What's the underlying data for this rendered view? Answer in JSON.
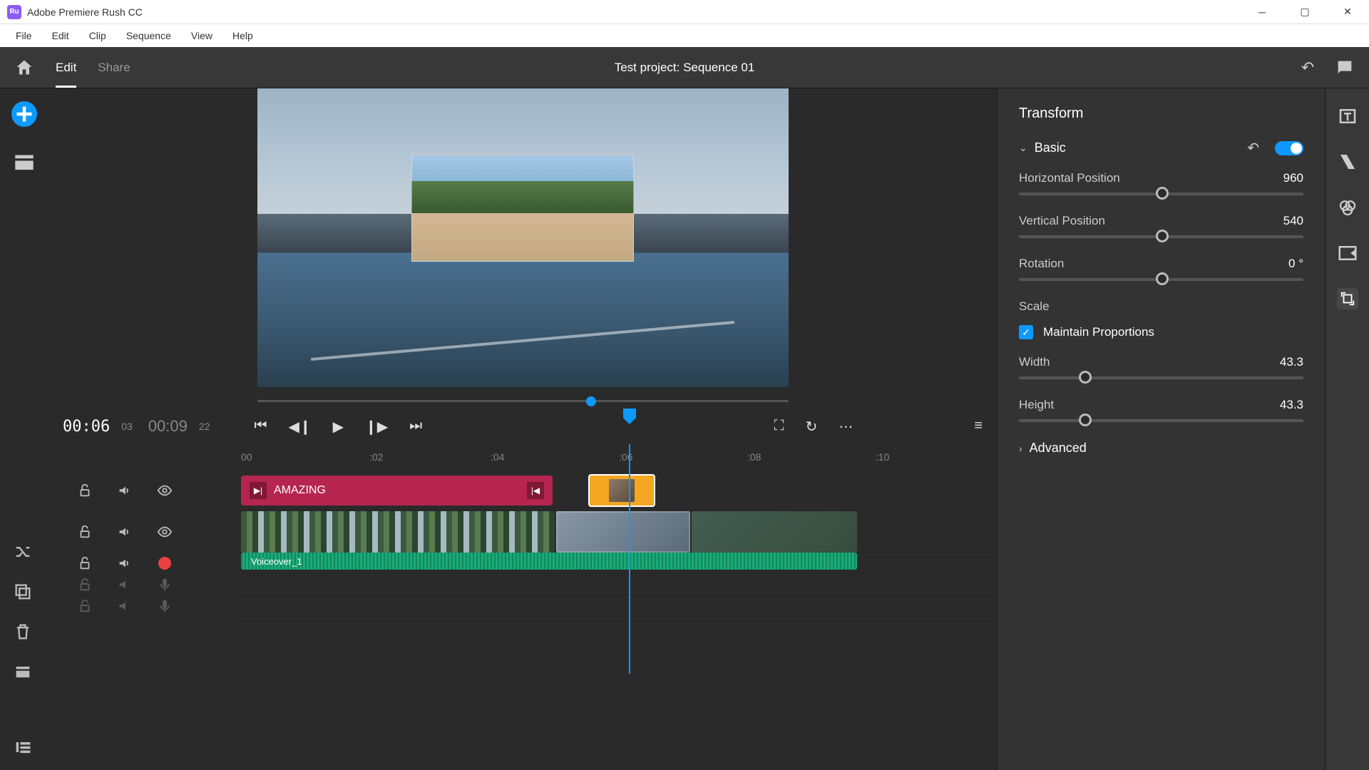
{
  "titlebar": {
    "appName": "Adobe Premiere Rush CC"
  },
  "menubar": {
    "items": [
      "File",
      "Edit",
      "Clip",
      "Sequence",
      "View",
      "Help"
    ]
  },
  "topbar": {
    "modes": {
      "edit": "Edit",
      "share": "Share"
    },
    "projectTitle": "Test project: Sequence 01"
  },
  "transport": {
    "currentTime": "00:06",
    "currentFrames": "03",
    "duration": "00:09",
    "durationFrames": "22"
  },
  "ruler": {
    "t1": "00",
    "t2": ":02",
    "t3": ":04",
    "t4": ":06",
    "t5": ":08",
    "t6": ":10"
  },
  "tracks": {
    "titleClip": "AMAZING",
    "voiceover": "Voiceover_1"
  },
  "panel": {
    "title": "Transform",
    "basic": "Basic",
    "hpos": {
      "label": "Horizontal Position",
      "value": "960"
    },
    "vpos": {
      "label": "Vertical Position",
      "value": "540"
    },
    "rot": {
      "label": "Rotation",
      "value": "0 °"
    },
    "scale": "Scale",
    "maintain": "Maintain Proportions",
    "width": {
      "label": "Width",
      "value": "43.3"
    },
    "height": {
      "label": "Height",
      "value": "43.3"
    },
    "advanced": "Advanced"
  }
}
